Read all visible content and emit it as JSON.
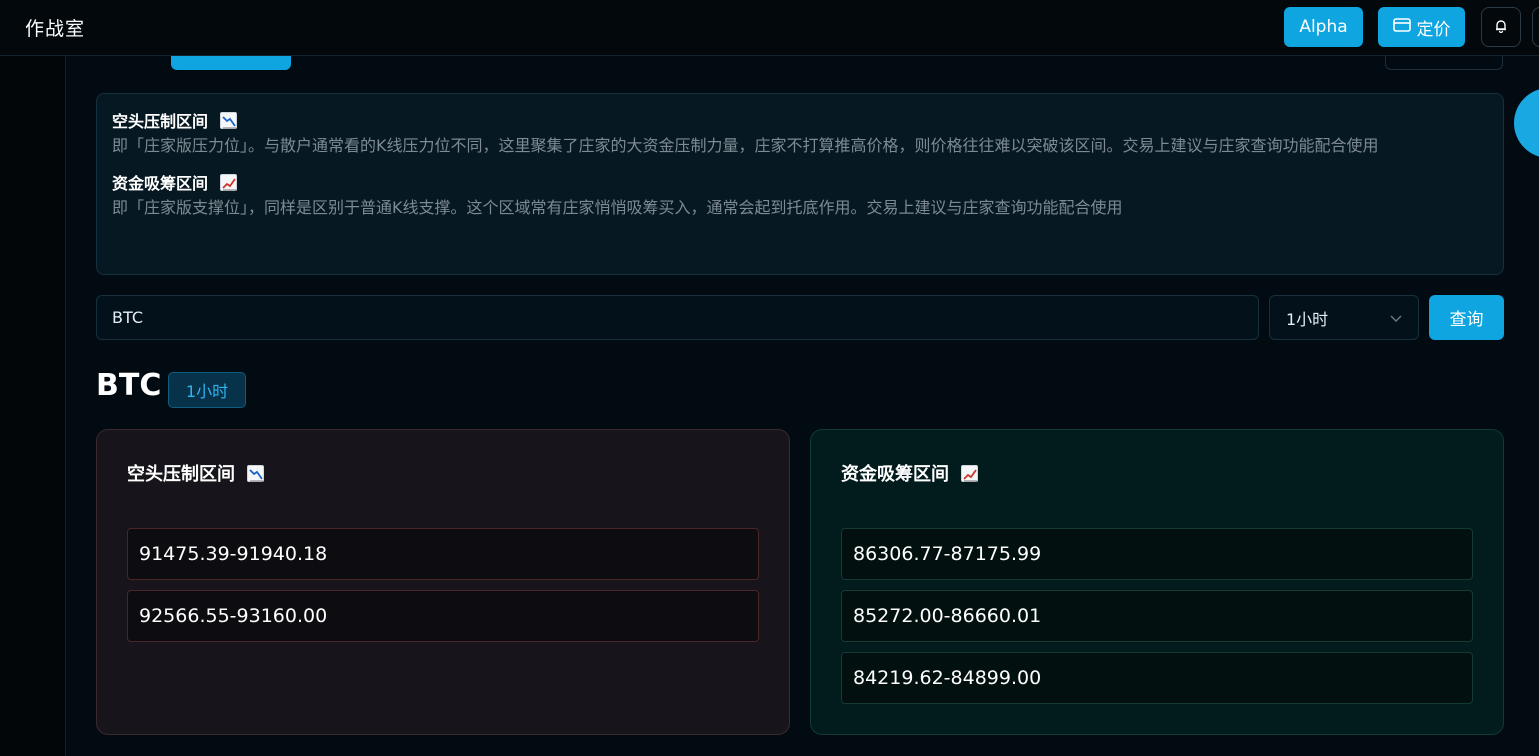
{
  "header": {
    "app_title": "作战室",
    "alpha_label": "Alpha",
    "pricing_label": "定价",
    "icons": [
      "card-icon",
      "bell-icon"
    ]
  },
  "info": {
    "bearish": {
      "title": "空头压制区间",
      "icon": "chart-decreasing-icon",
      "description": "即「庄家版压力位」。与散户通常看的K线压力位不同，这里聚集了庄家的大资金压制力量，庄家不打算推高价格，则价格往往难以突破该区间。交易上建议与庄家查询功能配合使用"
    },
    "bullish": {
      "title": "资金吸筹区间",
      "icon": "chart-increasing-icon",
      "description": "即「庄家版支撑位」，同样是区别于普通K线支撑。这个区域常有庄家悄悄吸筹买入，通常会起到托底作用。交易上建议与庄家查询功能配合使用"
    }
  },
  "query": {
    "symbol_value": "BTC",
    "interval_value": "1小时",
    "submit_label": "查询"
  },
  "result": {
    "symbol": "BTC",
    "interval_tag": "1小时",
    "bear_card": {
      "title": "空头压制区间",
      "ranges": [
        "91475.39-91940.18",
        "92566.55-93160.00"
      ]
    },
    "bull_card": {
      "title": "资金吸筹区间",
      "ranges": [
        "86306.77-87175.99",
        "85272.00-86660.01",
        "84219.62-84899.00"
      ]
    }
  },
  "colors": {
    "accent": "#0ea5e0",
    "bear_border": "#4a2628",
    "bull_border": "#153a35"
  }
}
